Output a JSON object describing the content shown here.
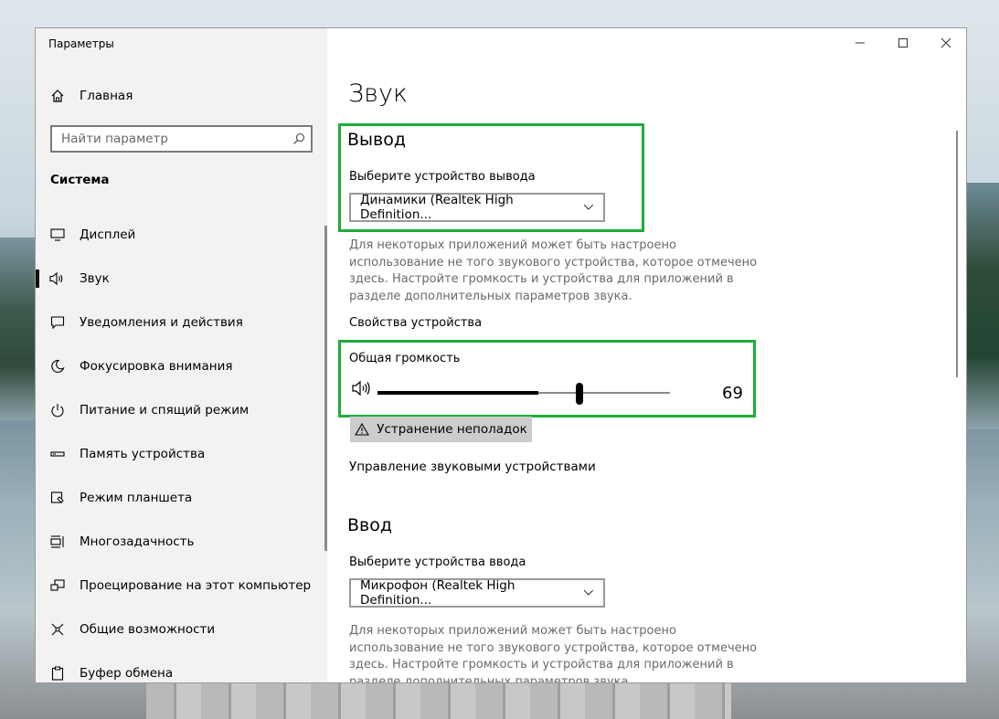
{
  "app": {
    "title": "Параметры"
  },
  "sidebar": {
    "home_label": "Главная",
    "search_placeholder": "Найти параметр",
    "section_label": "Система",
    "items": [
      {
        "label": "Дисплей",
        "icon": "monitor-icon"
      },
      {
        "label": "Звук",
        "icon": "speaker-icon",
        "active": true
      },
      {
        "label": "Уведомления и действия",
        "icon": "notification-icon"
      },
      {
        "label": "Фокусировка внимания",
        "icon": "moon-icon"
      },
      {
        "label": "Питание и спящий режим",
        "icon": "power-icon"
      },
      {
        "label": "Память устройства",
        "icon": "storage-icon"
      },
      {
        "label": "Режим планшета",
        "icon": "tablet-icon"
      },
      {
        "label": "Многозадачность",
        "icon": "multitask-icon"
      },
      {
        "label": "Проецирование на этот компьютер",
        "icon": "project-icon"
      },
      {
        "label": "Общие возможности",
        "icon": "shared-icon"
      },
      {
        "label": "Буфер обмена",
        "icon": "clipboard-icon"
      }
    ]
  },
  "main": {
    "title": "Звук",
    "output": {
      "heading": "Вывод",
      "select_label": "Выберите устройство вывода",
      "device": "Динамики (Realtek High Definition...",
      "hint": "Для некоторых приложений может быть настроено использование не того звукового устройства, которое отмечено здесь. Настройте громкость и устройства для приложений в разделе дополнительных параметров звука.",
      "properties_link": "Свойства устройства",
      "volume_label": "Общая громкость",
      "volume": 69,
      "volume_text": "69",
      "troubleshoot_label": "Устранение неполадок",
      "manage_link": "Управление звуковыми устройствами"
    },
    "input": {
      "heading": "Ввод",
      "select_label": "Выберите устройства ввода",
      "device": "Микрофон (Realtek High Definition...",
      "hint": "Для некоторых приложений может быть настроено использование не того звукового устройства, которое отмечено здесь. Настройте громкость и устройства для приложений в разделе дополнительных параметров звука."
    }
  },
  "colors": {
    "highlight": "#1ead3a",
    "sidebar_bg": "#f2f2f2"
  }
}
